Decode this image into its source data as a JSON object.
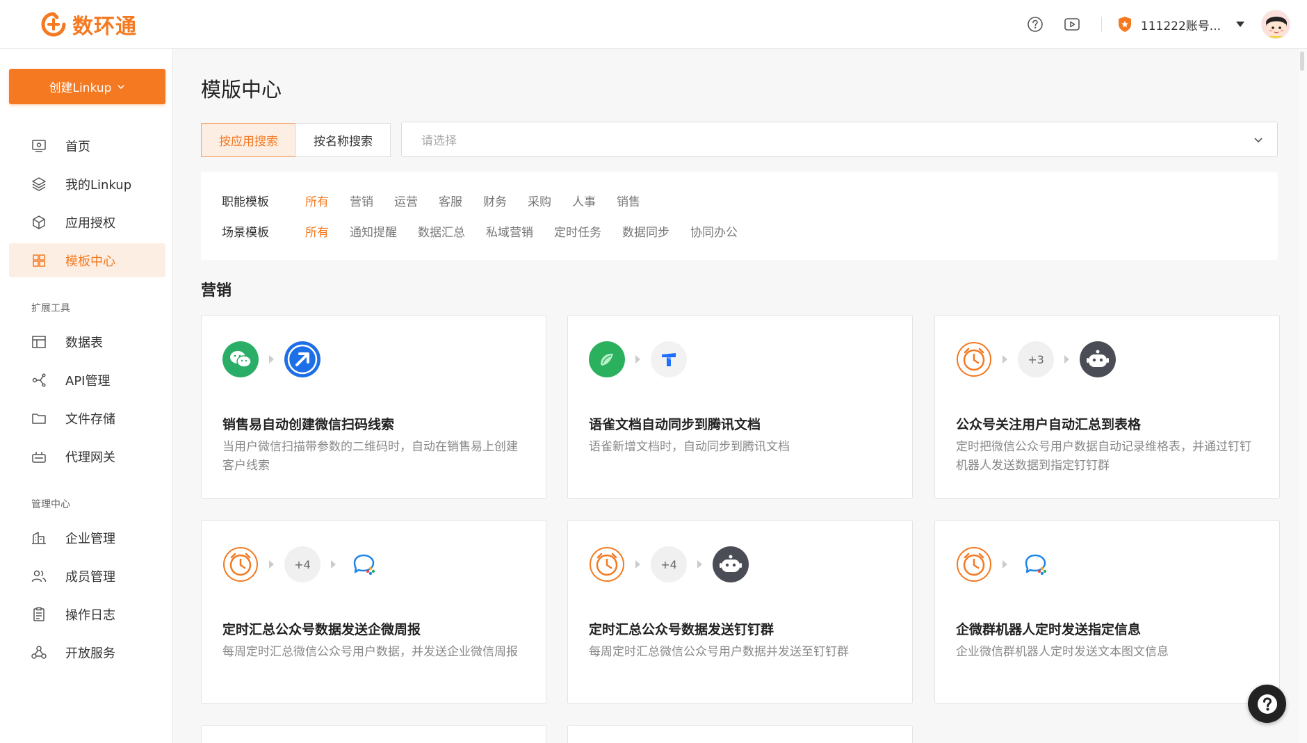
{
  "brand": {
    "name": "数环通",
    "accent": "#f47920"
  },
  "topbar": {
    "help_icon": "question-circle-icon",
    "video_icon": "video-play-icon",
    "account_name": "111222账号...",
    "badge_icon": "shield-star-icon"
  },
  "sidebar": {
    "create_label": "创建Linkup",
    "items": [
      {
        "label": "首页",
        "icon": "monitor-icon"
      },
      {
        "label": "我的Linkup",
        "icon": "layers-icon"
      },
      {
        "label": "应用授权",
        "icon": "cube-icon"
      },
      {
        "label": "模板中心",
        "icon": "grid-icon",
        "active": true
      }
    ],
    "section_tools": "扩展工具",
    "tools": [
      {
        "label": "数据表",
        "icon": "table-icon"
      },
      {
        "label": "API管理",
        "icon": "api-icon"
      },
      {
        "label": "文件存储",
        "icon": "folder-icon"
      },
      {
        "label": "代理网关",
        "icon": "gateway-icon"
      }
    ],
    "section_admin": "管理中心",
    "admin": [
      {
        "label": "企业管理",
        "icon": "building-icon"
      },
      {
        "label": "成员管理",
        "icon": "users-icon"
      },
      {
        "label": "操作日志",
        "icon": "clipboard-icon"
      },
      {
        "label": "开放服务",
        "icon": "open-service-icon"
      }
    ]
  },
  "main": {
    "title": "模版中心",
    "search_tabs": [
      "按应用搜索",
      "按名称搜索"
    ],
    "select_placeholder": "请选择",
    "filters": {
      "function_label": "职能模板",
      "function_options": [
        "所有",
        "营销",
        "运营",
        "客服",
        "财务",
        "采购",
        "人事",
        "销售"
      ],
      "scene_label": "场景模板",
      "scene_options": [
        "所有",
        "通知提醒",
        "数据汇总",
        "私域营销",
        "定时任务",
        "数据同步",
        "协同办公"
      ]
    },
    "section_title": "营销",
    "cards": [
      {
        "title": "销售易自动创建微信扫码线索",
        "desc": "当用户微信扫描带参数的二维码时，自动在销售易上创建客户线索",
        "icons": [
          "wechat-icon",
          "xiaoshouyi-arrow-icon"
        ]
      },
      {
        "title": "语雀文档自动同步到腾讯文档",
        "desc": "语雀新增文档时，自动同步到腾讯文档",
        "icons": [
          "yuque-bird-icon",
          "tencent-docs-icon"
        ]
      },
      {
        "title": "公众号关注用户自动汇总到表格",
        "desc": "定时把微信公众号用户数据自动记录维格表，并通过钉钉机器人发送数据到指定钉钉群",
        "icons": [
          "alarm-clock-icon",
          "+3",
          "robot-icon"
        ]
      },
      {
        "title": "定时汇总公众号数据发送企微周报",
        "desc": "每周定时汇总微信公众号用户数据，并发送企业微信周报",
        "icons": [
          "alarm-clock-icon",
          "+4",
          "wecom-chat-icon"
        ]
      },
      {
        "title": "定时汇总公众号数据发送钉钉群",
        "desc": "每周定时汇总微信公众号用户数据并发送至钉钉群",
        "icons": [
          "alarm-clock-icon",
          "+4",
          "robot-icon"
        ]
      },
      {
        "title": "企微群机器人定时发送指定信息",
        "desc": "企业微信群机器人定时发送文本图文信息",
        "icons": [
          "alarm-clock-icon",
          "wecom-chat-icon"
        ]
      }
    ]
  },
  "help_fab_icon": "help-question-icon"
}
